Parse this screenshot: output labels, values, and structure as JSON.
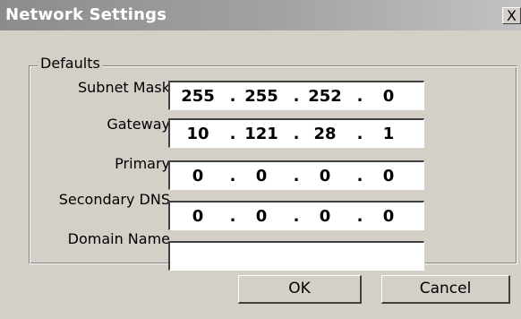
{
  "window": {
    "title": "Network Settings",
    "close_label": "X"
  },
  "group": {
    "legend": "Defaults"
  },
  "fields": {
    "subnet_mask": {
      "label": "Subnet Mask",
      "octets": [
        "255",
        "255",
        "252",
        "0"
      ]
    },
    "gateway": {
      "label": "Gateway",
      "octets": [
        "10",
        "121",
        "28",
        "1"
      ]
    },
    "primary": {
      "label": "Primary",
      "octets": [
        "0",
        "0",
        "0",
        "0"
      ]
    },
    "secondary_dns": {
      "label": "Secondary DNS",
      "octets": [
        "0",
        "0",
        "0",
        "0"
      ]
    },
    "domain_name": {
      "label": "Domain Name",
      "value": ""
    }
  },
  "separator": ".",
  "buttons": {
    "ok": "OK",
    "cancel": "Cancel"
  }
}
